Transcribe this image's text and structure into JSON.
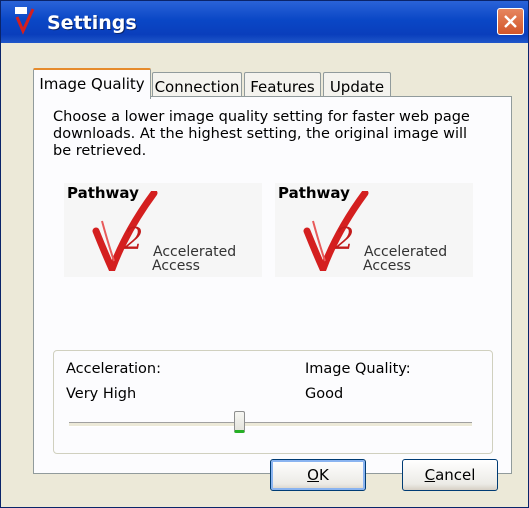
{
  "window": {
    "title": "Settings"
  },
  "tabs": [
    {
      "label": "Image Quality",
      "active": true
    },
    {
      "label": "Connection",
      "active": false
    },
    {
      "label": "Features",
      "active": false
    },
    {
      "label": "Update",
      "active": false
    }
  ],
  "panel": {
    "description": "Choose a lower image quality setting for faster web page downloads. At the highest setting, the original image will be retrieved.",
    "logos": [
      {
        "word": "Pathway",
        "line1": "Accelerated",
        "line2": "Access"
      },
      {
        "word": "Pathway",
        "line1": "Accelerated",
        "line2": "Access"
      }
    ],
    "acceleration_label": "Acceleration:",
    "acceleration_value": "Very High",
    "quality_label": "Image Quality:",
    "quality_value": "Good",
    "slider_level": 0.42
  },
  "buttons": {
    "ok_mnemonic": "O",
    "ok_rest": "K",
    "cancel_mnemonic": "C",
    "cancel_rest": "ancel"
  },
  "colors": {
    "title_bar": "#0a47c6",
    "close_button": "#d2552a",
    "tab_accent": "#e68b2c",
    "slider_thumb_accent": "#26b026"
  },
  "icons": {
    "app": "pathway-app-icon",
    "close": "close-icon"
  }
}
